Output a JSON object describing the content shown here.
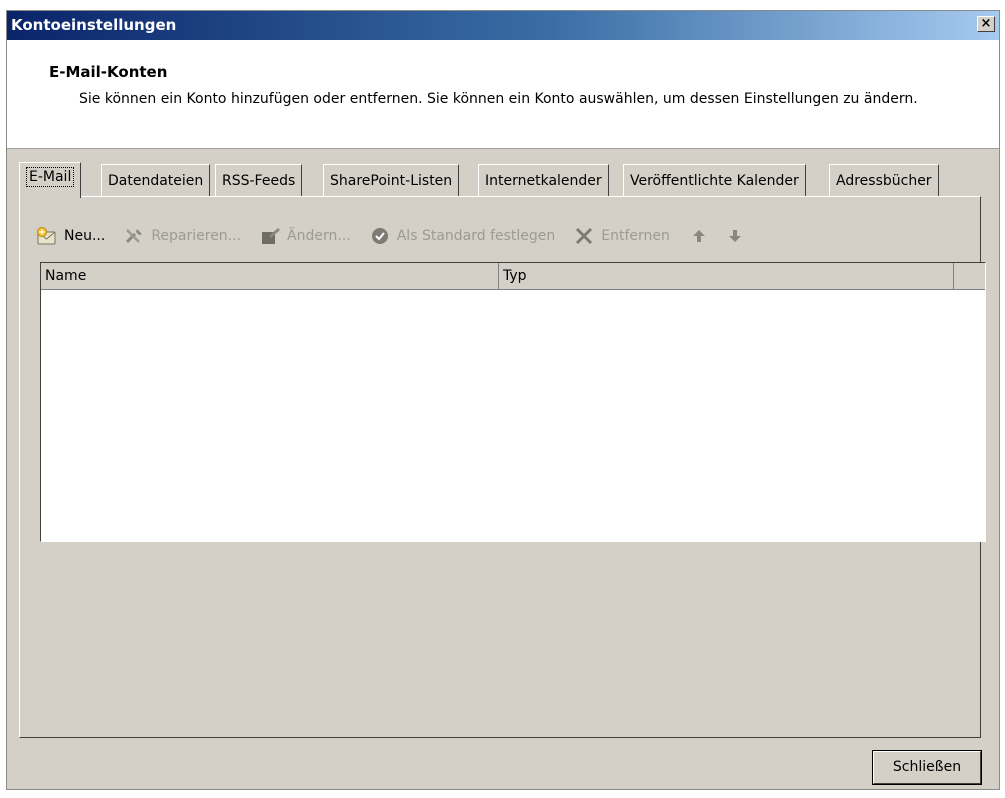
{
  "window": {
    "title": "Kontoeinstellungen",
    "close_label": "×"
  },
  "header": {
    "title": "E-Mail-Konten",
    "description": "Sie können ein Konto hinzufügen oder entfernen. Sie können ein Konto auswählen, um dessen Einstellungen zu ändern."
  },
  "tabs": [
    {
      "label": "E-Mail",
      "active": true
    },
    {
      "label": "Datendateien"
    },
    {
      "label": "RSS-Feeds"
    },
    {
      "label": "SharePoint-Listen"
    },
    {
      "label": "Internetkalender"
    },
    {
      "label": "Veröffentlichte Kalender"
    },
    {
      "label": "Adressbücher"
    }
  ],
  "toolbar": {
    "new": {
      "label": "Neu...",
      "icon": "new-account-icon"
    },
    "repair": {
      "label": "Reparieren...",
      "icon": "repair-icon",
      "disabled": true
    },
    "change": {
      "label": "Ändern...",
      "icon": "change-icon",
      "disabled": true
    },
    "set_default": {
      "label": "Als Standard festlegen",
      "icon": "checkmark-icon",
      "disabled": true
    },
    "remove": {
      "label": "Entfernen",
      "icon": "remove-icon",
      "disabled": true
    },
    "move_up_icon": "arrow-up-icon",
    "move_down_icon": "arrow-down-icon"
  },
  "account_list": {
    "columns": [
      "Name",
      "Typ"
    ],
    "rows": []
  },
  "footer": {
    "close_label": "Schließen"
  }
}
